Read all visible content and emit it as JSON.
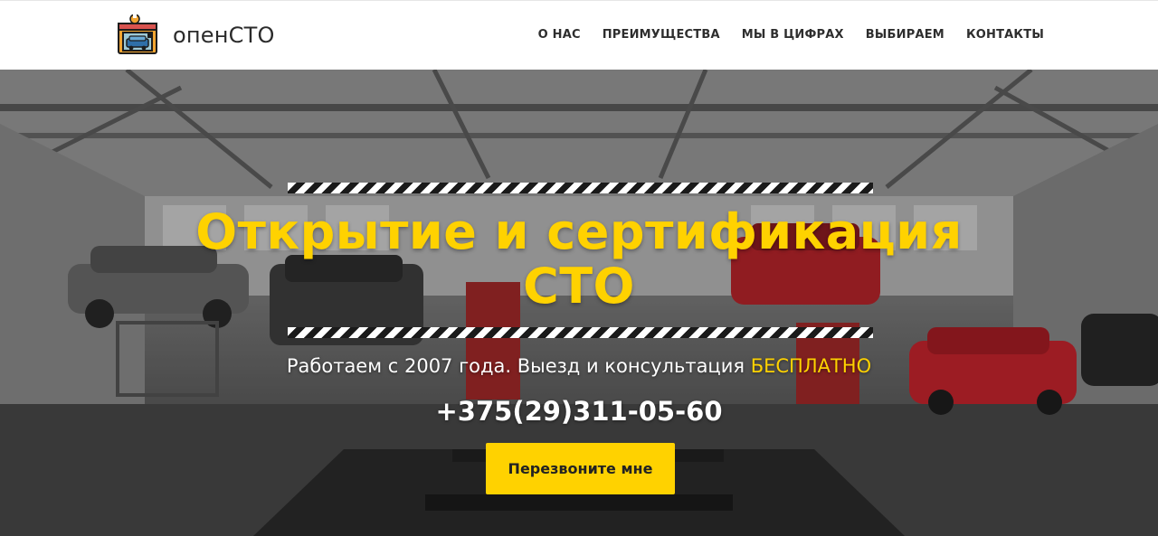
{
  "header": {
    "brand": "опенСТО",
    "logo_icon": "car-service-garage-icon",
    "nav": [
      {
        "id": "about",
        "label": "О НАС"
      },
      {
        "id": "advantages",
        "label": "ПРЕИМУЩЕСТВА"
      },
      {
        "id": "numbers",
        "label": "МЫ В ЦИФРАХ"
      },
      {
        "id": "choose",
        "label": "ВЫБИРАЕМ"
      },
      {
        "id": "contacts",
        "label": "КОНТАКТЫ"
      }
    ]
  },
  "hero": {
    "title_line1": "Открытие и сертификация",
    "title_line2": "СТО",
    "subtitle_main": "Работаем с 2007 года. Выезд и консультация ",
    "subtitle_accent": "БЕСПЛАТНО",
    "phone": "+375(29)311-05-60",
    "cta_label": "Перезвоните мне",
    "background_description_icon": "car-service-workshop-photo"
  },
  "colors": {
    "accent": "#ffd200",
    "header_bg": "#ffffff",
    "nav_text": "#2e2e2e",
    "hero_text": "#ffffff"
  }
}
